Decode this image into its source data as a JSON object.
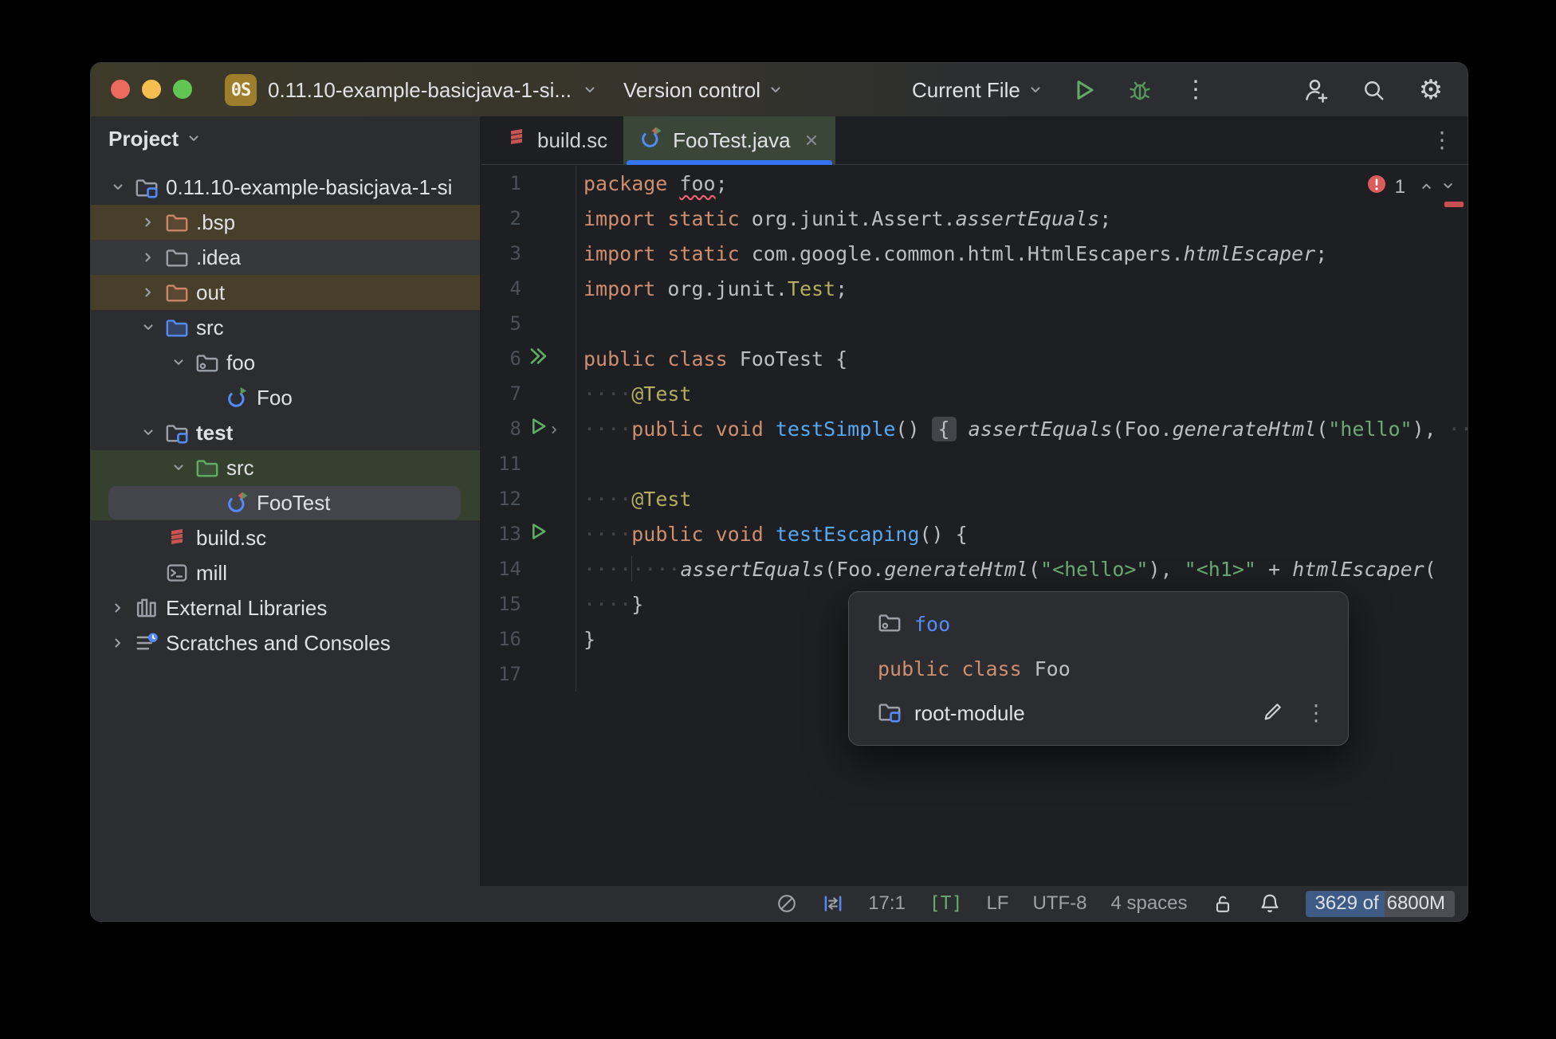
{
  "titlebar": {
    "badge": "0S",
    "title": "0.11.10-example-basicjava-1-si...",
    "vcs": "Version control",
    "run_config": "Current File"
  },
  "glyphs": {
    "gear": "⚙",
    "kebab": "⋮"
  },
  "colors": {
    "accent_blue": "#3574f0",
    "run_green": "#5fad65",
    "error_red": "#db5c5c",
    "string_green": "#6aab73",
    "keyword_orange": "#cf8e6d",
    "tab_active_bg": "#3a4637",
    "selection_gray": "#43454a"
  },
  "sidebar": {
    "header": "Project",
    "tree": [
      {
        "label": "0.11.10-example-basicjava-1-si",
        "icon": "module-folder",
        "chevron": "down",
        "depth": 0
      },
      {
        "label": ".bsp",
        "icon": "folder-brown",
        "chevron": "right",
        "depth": 1,
        "bg": "brown"
      },
      {
        "label": ".idea",
        "icon": "folder-gray",
        "chevron": "right",
        "depth": 1,
        "bg": "gray"
      },
      {
        "label": "out",
        "icon": "folder-brown",
        "chevron": "right",
        "depth": 1,
        "bg": "brown"
      },
      {
        "label": "src",
        "icon": "folder-blue",
        "chevron": "down",
        "depth": 1
      },
      {
        "label": "foo",
        "icon": "package",
        "chevron": "down",
        "depth": 2
      },
      {
        "label": "Foo",
        "icon": "class-run",
        "depth": 3
      },
      {
        "label": "test",
        "icon": "module-folder",
        "chevron": "down",
        "depth": 1,
        "bold": true
      },
      {
        "label": "src",
        "icon": "folder-green",
        "chevron": "down",
        "depth": 2,
        "bg": "green"
      },
      {
        "label": "FooTest",
        "icon": "test-class",
        "depth": 3,
        "bg": "green",
        "selected": true
      },
      {
        "label": "build.sc",
        "icon": "scala",
        "depth": 1
      },
      {
        "label": "mill",
        "icon": "terminal",
        "depth": 1
      },
      {
        "label": "External Libraries",
        "icon": "library",
        "chevron": "right",
        "depth": 0
      },
      {
        "label": "Scratches and Consoles",
        "icon": "scratches",
        "chevron": "right",
        "depth": 0
      }
    ]
  },
  "tabs": [
    {
      "label": "build.sc",
      "icon": "scala"
    },
    {
      "label": "FooTest.java",
      "icon": "test-class",
      "active": true,
      "closable": true
    }
  ],
  "editor": {
    "error_count": "1",
    "lines": [
      {
        "n": "1",
        "segs": [
          [
            "k",
            "package"
          ],
          [
            "p",
            " "
          ],
          [
            "e",
            "foo"
          ],
          [
            "p",
            ";"
          ]
        ]
      },
      {
        "n": "2",
        "segs": [
          [
            "k",
            "import"
          ],
          [
            "p",
            " "
          ],
          [
            "k",
            "static"
          ],
          [
            "p",
            " org.junit.Assert."
          ],
          [
            "m",
            "assertEquals"
          ],
          [
            "p",
            ";"
          ]
        ]
      },
      {
        "n": "3",
        "segs": [
          [
            "k",
            "import"
          ],
          [
            "p",
            " "
          ],
          [
            "k",
            "static"
          ],
          [
            "p",
            " com.google.common.html.HtmlEscapers."
          ],
          [
            "m",
            "htmlEscaper"
          ],
          [
            "p",
            ";"
          ]
        ]
      },
      {
        "n": "4",
        "segs": [
          [
            "k",
            "import"
          ],
          [
            "p",
            " org.junit."
          ],
          [
            "a",
            "Test"
          ],
          [
            "p",
            ";"
          ]
        ]
      },
      {
        "n": "5",
        "segs": []
      },
      {
        "n": "6",
        "icon": "run-all",
        "segs": [
          [
            "k",
            "public"
          ],
          [
            "p",
            " "
          ],
          [
            "k",
            "class"
          ],
          [
            "p",
            " FooTest {"
          ]
        ]
      },
      {
        "n": "7",
        "segs": [
          [
            "w",
            "····"
          ],
          [
            "a",
            "@Test"
          ]
        ]
      },
      {
        "n": "8",
        "icon": "run",
        "fold": true,
        "segs": [
          [
            "w",
            "····"
          ],
          [
            "k",
            "public"
          ],
          [
            "p",
            " "
          ],
          [
            "k",
            "void"
          ],
          [
            "p",
            " "
          ],
          [
            "d",
            "testSimple"
          ],
          [
            "p",
            "() "
          ],
          [
            "f",
            "{"
          ],
          [
            "p",
            " "
          ],
          [
            "m",
            "assertEquals"
          ],
          [
            "p",
            "(Foo."
          ],
          [
            "m",
            "generateHtml"
          ],
          [
            "p",
            "("
          ],
          [
            "s",
            "\"hello\""
          ],
          [
            "p",
            "), "
          ],
          [
            "w",
            "··"
          ]
        ]
      },
      {
        "n": "11",
        "segs": []
      },
      {
        "n": "12",
        "segs": [
          [
            "w",
            "····"
          ],
          [
            "a",
            "@Test"
          ]
        ]
      },
      {
        "n": "13",
        "icon": "run",
        "segs": [
          [
            "w",
            "····"
          ],
          [
            "k",
            "public"
          ],
          [
            "p",
            " "
          ],
          [
            "k",
            "void"
          ],
          [
            "p",
            " "
          ],
          [
            "d",
            "testEscaping"
          ],
          [
            "p",
            "() {"
          ]
        ]
      },
      {
        "n": "14",
        "segs": [
          [
            "w",
            "····"
          ],
          [
            "gd",
            ""
          ],
          [
            "w",
            "····"
          ],
          [
            "m",
            "assertEquals"
          ],
          [
            "p",
            "(Foo."
          ],
          [
            "m",
            "generateHtml"
          ],
          [
            "p",
            "("
          ],
          [
            "s",
            "\"<hello>\""
          ],
          [
            "p",
            "), "
          ],
          [
            "s",
            "\"<h1>\""
          ],
          [
            "p",
            " + "
          ],
          [
            "m",
            "htmlEscaper"
          ],
          [
            "p",
            "("
          ]
        ]
      },
      {
        "n": "15",
        "segs": [
          [
            "w",
            "····"
          ],
          [
            "p",
            "}"
          ]
        ]
      },
      {
        "n": "16",
        "segs": [
          [
            "p",
            "}"
          ]
        ]
      },
      {
        "n": "17",
        "segs": []
      }
    ]
  },
  "popup": {
    "package_name": "foo",
    "class_keywords": "public class ",
    "class_name": "Foo",
    "module_name": "root-module"
  },
  "statusbar": {
    "position": "17:1",
    "t_badge": "[T]",
    "line_ending": "LF",
    "encoding": "UTF-8",
    "indent": "4 spaces",
    "memory_used": "3629 of",
    "memory_total": "6800M"
  }
}
